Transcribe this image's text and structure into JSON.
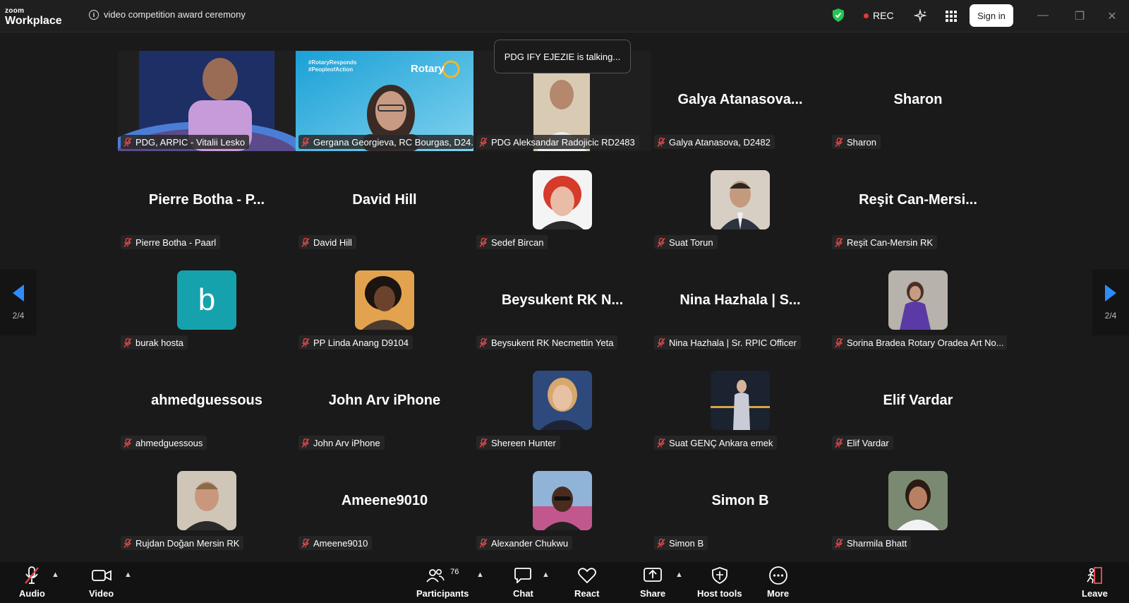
{
  "app": {
    "brand_top": "zoom",
    "brand_bottom": "Workplace"
  },
  "meeting": {
    "title": "video competition award ceremony"
  },
  "status": {
    "rec_label": "REC",
    "signin_label": "Sign in"
  },
  "toast": {
    "text": "PDG IFY EJEZIE is talking..."
  },
  "pagination": {
    "left": "2/4",
    "right": "2/4"
  },
  "tiles": [
    {
      "label": "PDG, ARPIC - Vitalii Lesko",
      "big": ""
    },
    {
      "label": "Gergana Georgieva, RC Bourgas, D24...",
      "big": ""
    },
    {
      "label": "PDG Aleksandar Radojicic  RD2483",
      "big": ""
    },
    {
      "label": "Galya Atanasova, D2482",
      "big": "Galya  Atanasova..."
    },
    {
      "label": "Sharon",
      "big": "Sharon"
    },
    {
      "label": "Pierre Botha - Paarl",
      "big": "Pierre  Botha  -  P..."
    },
    {
      "label": "David Hill",
      "big": "David Hill"
    },
    {
      "label": "Sedef Bircan",
      "big": ""
    },
    {
      "label": "Suat Torun",
      "big": ""
    },
    {
      "label": "Reşit Can-Mersin RK",
      "big": "Reşit  Can-Mersi..."
    },
    {
      "label": "burak hosta",
      "big": "",
      "letter": "b"
    },
    {
      "label": "PP Linda Anang D9104",
      "big": ""
    },
    {
      "label": "Beysukent RK Necmettin Yeta",
      "big": "Beysukent  RK  N..."
    },
    {
      "label": "Nina Hazhala | Sr. RPIC Officer",
      "big": "Nina  Hazhala  |  S..."
    },
    {
      "label": "Sorina Bradea Rotary Oradea Art No...",
      "big": ""
    },
    {
      "label": "ahmedguessous",
      "big": "ahmedguessous"
    },
    {
      "label": "John Arv iPhone",
      "big": "John Arv iPhone"
    },
    {
      "label": "Shereen Hunter",
      "big": ""
    },
    {
      "label": "Suat GENÇ Ankara emek",
      "big": ""
    },
    {
      "label": "Elif Vardar",
      "big": "Elif Vardar"
    },
    {
      "label": "Rujdan Doğan  Mersin RK",
      "big": ""
    },
    {
      "label": "Ameene9010",
      "big": "Ameene9010"
    },
    {
      "label": "Alexander Chukwu",
      "big": ""
    },
    {
      "label": "Simon B",
      "big": "Simon B"
    },
    {
      "label": "Sharmila Bhatt",
      "big": ""
    }
  ],
  "video_overlay": {
    "line1": "#RotaryResponds",
    "line2": "#PeopleofAction",
    "brand": "Rotary"
  },
  "toolbar": {
    "audio": "Audio",
    "video": "Video",
    "participants": "Participants",
    "participants_count": "76",
    "chat": "Chat",
    "react": "React",
    "share": "Share",
    "host_tools": "Host tools",
    "more": "More",
    "leave": "Leave"
  },
  "colors": {
    "accent": "#2d8cff",
    "rec": "#e53935",
    "muted": "#e04848",
    "letter_avatar": "#15a2ad"
  }
}
